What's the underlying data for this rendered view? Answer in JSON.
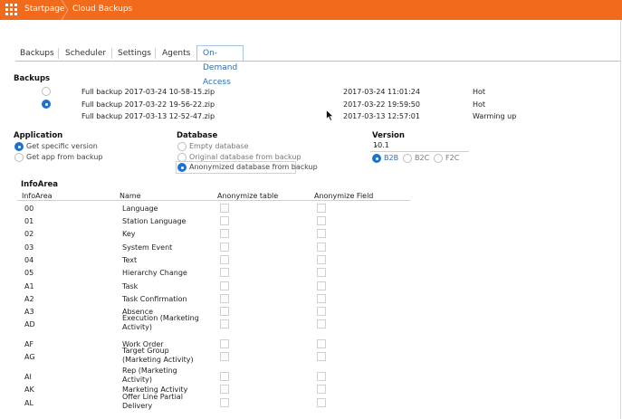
{
  "header": {
    "startpage_label": "Startpage",
    "current_label": "Cloud Backups",
    "accent_color": "#f26b1d"
  },
  "tabs": [
    {
      "label": "Backups",
      "active": false
    },
    {
      "label": "Scheduler",
      "active": false
    },
    {
      "label": "Settings",
      "active": false
    },
    {
      "label": "Agents",
      "active": false
    },
    {
      "label": "On-Demand Access",
      "active": true
    }
  ],
  "backups": {
    "title": "Backups",
    "items": [
      {
        "name": "Full backup 2017-03-24 10-58-15.zip",
        "date": "2017-03-24 11:01:24",
        "status": "Hot",
        "selected": false
      },
      {
        "name": "Full backup 2017-03-22 19-56-22.zip",
        "date": "2017-03-22 19:59:50",
        "status": "Hot",
        "selected": true
      },
      {
        "name": "Full backup 2017-03-13 12-52-47.zip",
        "date": "2017-03-13 12:57:01",
        "status": "Warming up",
        "selected": null
      }
    ]
  },
  "application": {
    "title": "Application",
    "options": [
      {
        "label": "Get specific version",
        "selected": true
      },
      {
        "label": "Get app from backup",
        "selected": false
      }
    ]
  },
  "database": {
    "title": "Database",
    "options": [
      {
        "label": "Empty database",
        "selected": false
      },
      {
        "label": "Original database from backup",
        "selected": false
      },
      {
        "label": "Anonymized database from backup",
        "selected": true
      }
    ]
  },
  "version": {
    "title": "Version",
    "selected": "10.1",
    "modes": [
      {
        "label": "B2B",
        "selected": true
      },
      {
        "label": "B2C",
        "selected": false
      },
      {
        "label": "F2C",
        "selected": false
      }
    ]
  },
  "infoarea": {
    "title": "InfoArea",
    "columns": [
      "InfoArea",
      "Name",
      "Anonymize table",
      "Anonymize Field"
    ],
    "rows": [
      {
        "code": "00",
        "name": "Language"
      },
      {
        "code": "01",
        "name": "Station Language"
      },
      {
        "code": "02",
        "name": "Key"
      },
      {
        "code": "03",
        "name": "System Event"
      },
      {
        "code": "04",
        "name": "Text"
      },
      {
        "code": "05",
        "name": "Hierarchy Change"
      },
      {
        "code": "A1",
        "name": "Task"
      },
      {
        "code": "A2",
        "name": "Task Confirmation"
      },
      {
        "code": "A3",
        "name": "Absence"
      },
      {
        "code": "AD",
        "name": "Execution (Marketing Activity)"
      },
      {
        "code": "AF",
        "name": "Work Order"
      },
      {
        "code": "AG",
        "name": "Target Group (Marketing Activity)"
      },
      {
        "code": "AI",
        "name": "Rep (Marketing Activity)"
      },
      {
        "code": "AK",
        "name": "Marketing Activity"
      },
      {
        "code": "AL",
        "name": "Offer Line Partial Delivery"
      }
    ]
  }
}
